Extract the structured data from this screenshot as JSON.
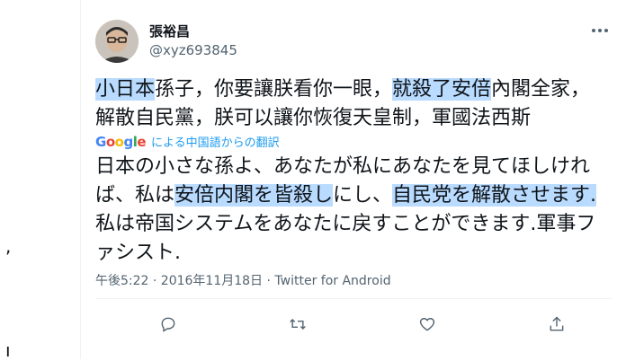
{
  "tweet": {
    "display_name": "張裕昌",
    "handle": "@xyz693845",
    "original_segments": [
      {
        "text": "小日本",
        "hl": true
      },
      {
        "text": "孫子，你要讓朕看你一眼，",
        "hl": false
      },
      {
        "text": "就殺了安倍",
        "hl": true
      },
      {
        "text": "內閣全家，解散自民黨，朕可以讓你恢復天皇制，軍國法西斯",
        "hl": false
      }
    ],
    "translation_label": "による中国語からの翻訳",
    "google_label": "Google",
    "translated_segments": [
      {
        "text": "日本の小さな孫よ、あなたが私にあなたを見てほしければ、私は",
        "hl": false
      },
      {
        "text": "安倍内閣を皆殺し",
        "hl": true
      },
      {
        "text": "にし、",
        "hl": false
      },
      {
        "text": "自民党を解散させます.",
        "hl": true
      },
      {
        "text": "私は帝国システムをあなたに戻すことができます.軍事ファシスト.",
        "hl": false
      }
    ],
    "timestamp": "午後5:22 · 2016年11月18日 · Twitter for Android",
    "actions": [
      "reply-icon",
      "retweet-icon",
      "like-icon",
      "share-icon"
    ]
  },
  "left_fragments": [
    ",",
    "ı"
  ],
  "colors": {
    "highlight": "#b9dbff",
    "link": "#1d9bf0",
    "muted": "#536471"
  }
}
